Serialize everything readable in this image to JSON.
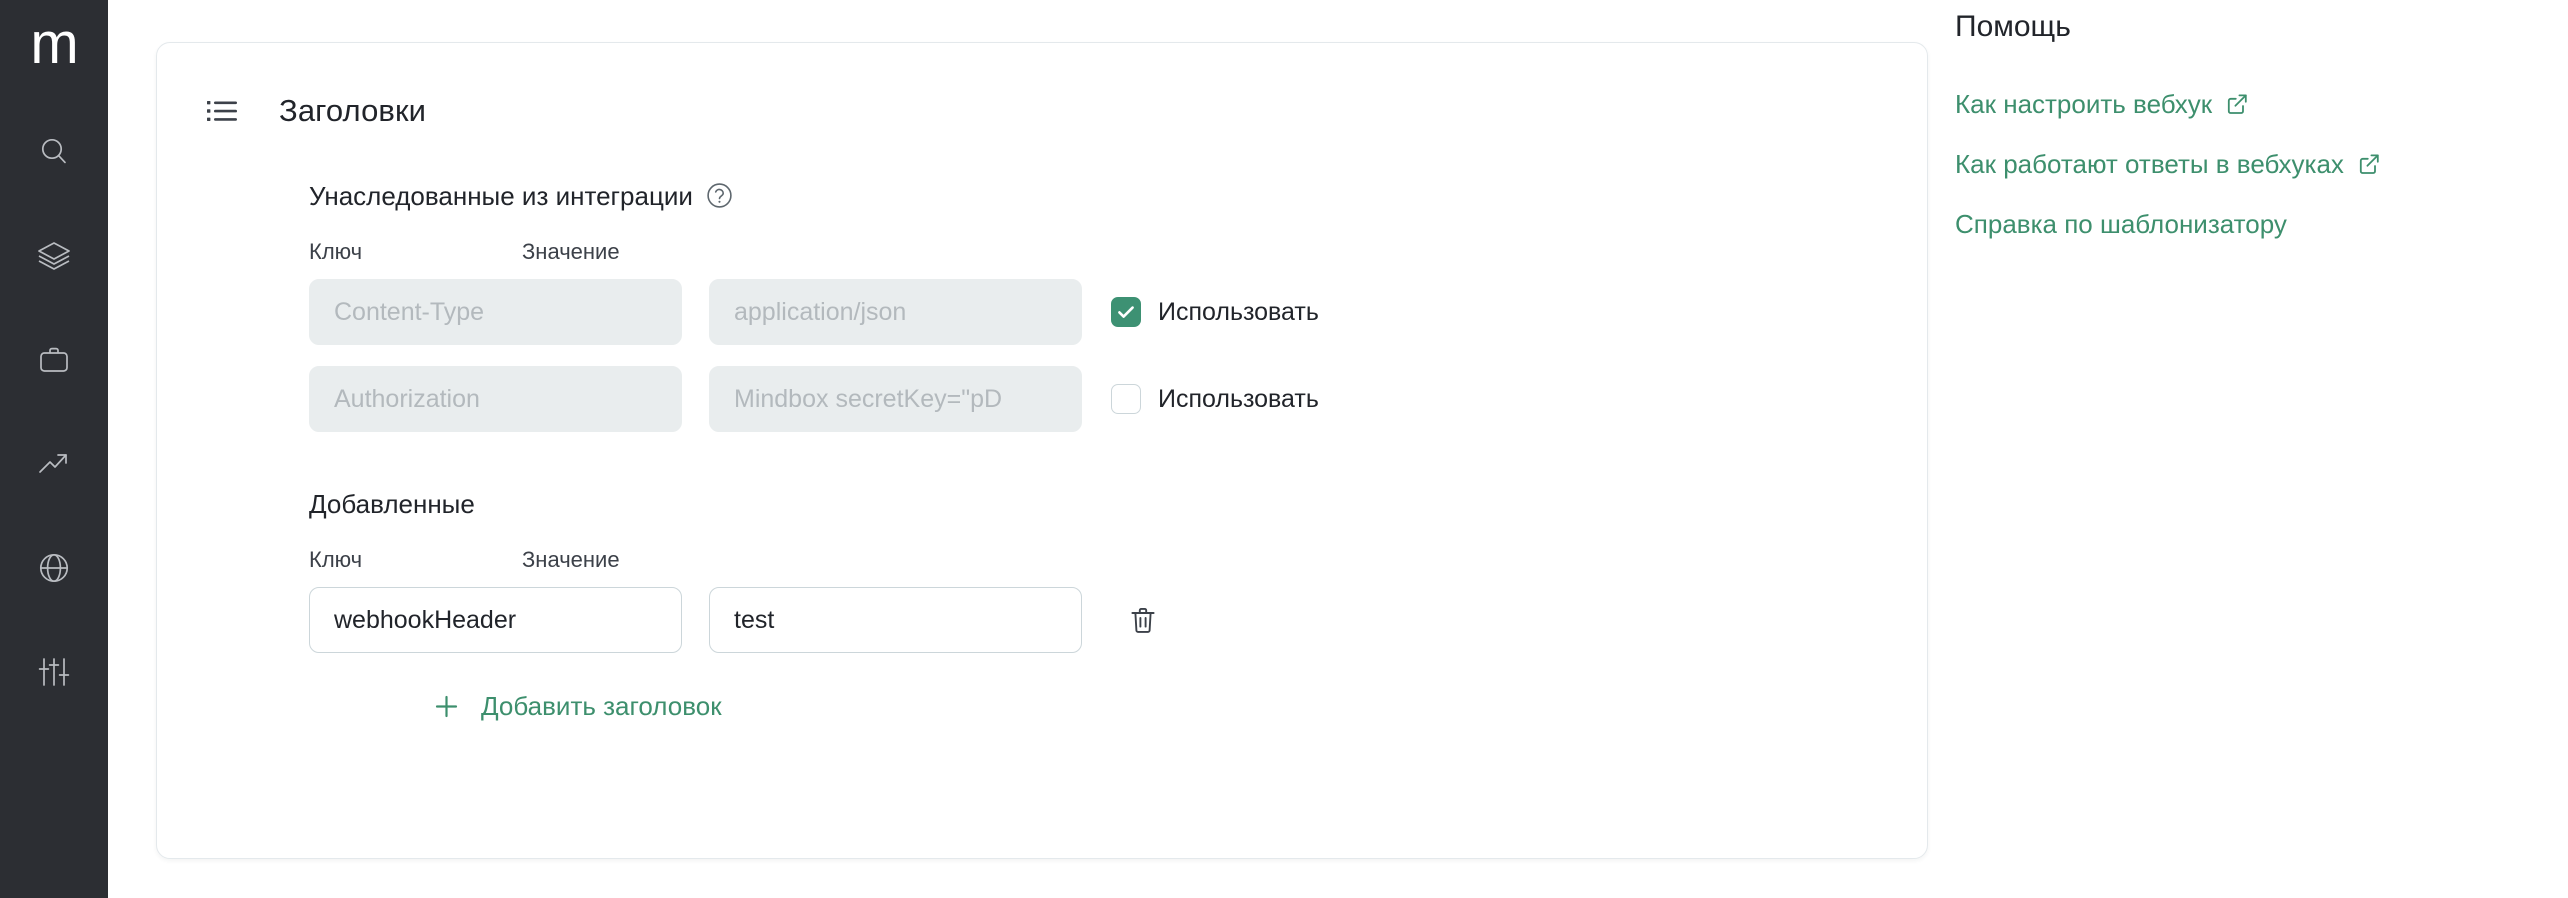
{
  "colors": {
    "sidebar_bg": "#2c2e33",
    "accent_green": "#3d8f6d",
    "checkbox_green": "#3d9173",
    "text_primary": "#21242a",
    "text_muted": "#b3b9bd",
    "card_border": "#e4e9ec",
    "field_disabled_bg": "#e9edee"
  },
  "sidebar": {
    "logo": "m",
    "items": [
      {
        "icon": "search-icon",
        "name": "sidebar-item-search"
      },
      {
        "icon": "layers-icon",
        "name": "sidebar-item-layers"
      },
      {
        "icon": "briefcase-icon",
        "name": "sidebar-item-briefcase"
      },
      {
        "icon": "trending-up-icon",
        "name": "sidebar-item-analytics"
      },
      {
        "icon": "globe-icon",
        "name": "sidebar-item-globe"
      },
      {
        "icon": "sliders-icon",
        "name": "sidebar-item-settings"
      }
    ]
  },
  "card": {
    "icon": "list-icon",
    "title": "Заголовки",
    "inherited": {
      "heading": "Унаследованные из интеграции",
      "help_icon": "question-circle-icon",
      "columns": {
        "key": "Ключ",
        "value": "Значение"
      },
      "rows": [
        {
          "key_placeholder": "Content-Type",
          "value_placeholder": "application/json",
          "use_label": "Использовать",
          "use_checked": true
        },
        {
          "key_placeholder": "Authorization",
          "value_placeholder": "Mindbox secretKey=\"pD",
          "use_label": "Использовать",
          "use_checked": false
        }
      ]
    },
    "added": {
      "heading": "Добавленные",
      "columns": {
        "key": "Ключ",
        "value": "Значение"
      },
      "rows": [
        {
          "key_value": "webhookHeader",
          "value_value": "test",
          "delete_icon": "trash-icon"
        }
      ],
      "add_button": {
        "icon": "plus-icon",
        "label": "Добавить заголовок"
      }
    }
  },
  "help": {
    "title": "Помощь",
    "links": [
      {
        "label": "Как настроить вебхук",
        "external": true
      },
      {
        "label": "Как работают ответы в вебхуках",
        "external": true
      },
      {
        "label": "Справка по шаблонизатору",
        "external": false
      }
    ]
  }
}
